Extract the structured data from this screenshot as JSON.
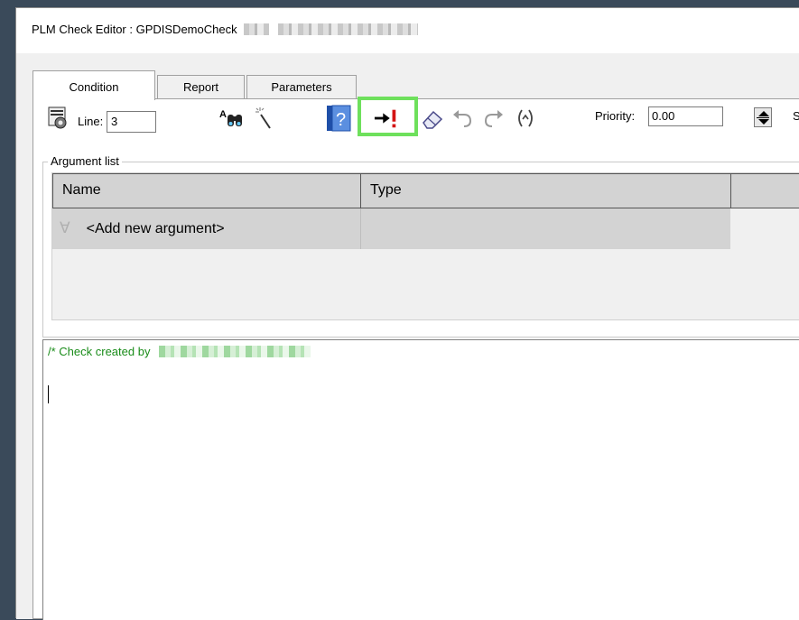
{
  "window": {
    "title": "PLM Check Editor : GPDISDemoCheck"
  },
  "tabs": [
    {
      "label": "Condition",
      "active": true
    },
    {
      "label": "Report",
      "active": false
    },
    {
      "label": "Parameters",
      "active": false
    }
  ],
  "toolbar": {
    "line_label": "Line:",
    "line_value": "3",
    "priority_label": "Priority:",
    "priority_value": "0.00",
    "cut_off_text": "S",
    "highlighted_button": "run-icon",
    "highlight_color": "#6ee05c",
    "icons": [
      "settings-icon",
      "find-icon",
      "wand-icon",
      "help-icon",
      "run-icon",
      "eraser-icon",
      "undo-icon",
      "redo-icon",
      "brackets-icon"
    ]
  },
  "argument_list": {
    "label": "Argument list",
    "columns": [
      "Name",
      "Type",
      ""
    ],
    "rows": [
      {
        "symbol": "∀",
        "name": "<Add new argument>",
        "type": ""
      }
    ]
  },
  "editor": {
    "comment": "/* Check created by",
    "comment_color": "#1a8c1a"
  }
}
